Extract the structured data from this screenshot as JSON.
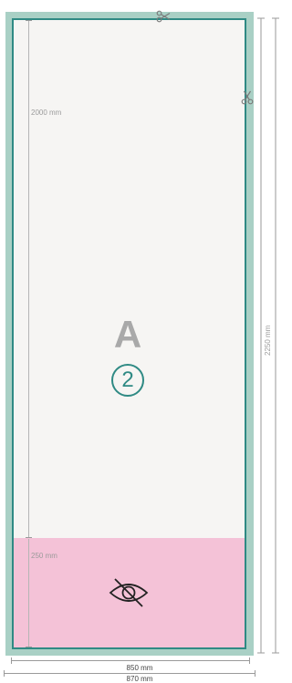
{
  "dimensions": {
    "visible_height": "2000 mm",
    "hidden_height": "250 mm",
    "total_height": "2250 mm",
    "visible_width": "850 mm",
    "total_width": "870 mm"
  },
  "panel": {
    "letter": "A",
    "number": "2"
  },
  "icons": {
    "cut_top": "scissors-icon",
    "cut_side": "scissors-icon",
    "hidden_zone": "eye-slash-icon"
  },
  "colors": {
    "bleed": "#a9d0c5",
    "trim_border": "#2f8a84",
    "panel_background": "#f6f5f3",
    "hidden_zone": "#f4c2d7",
    "letter": "#a9a9a9"
  }
}
